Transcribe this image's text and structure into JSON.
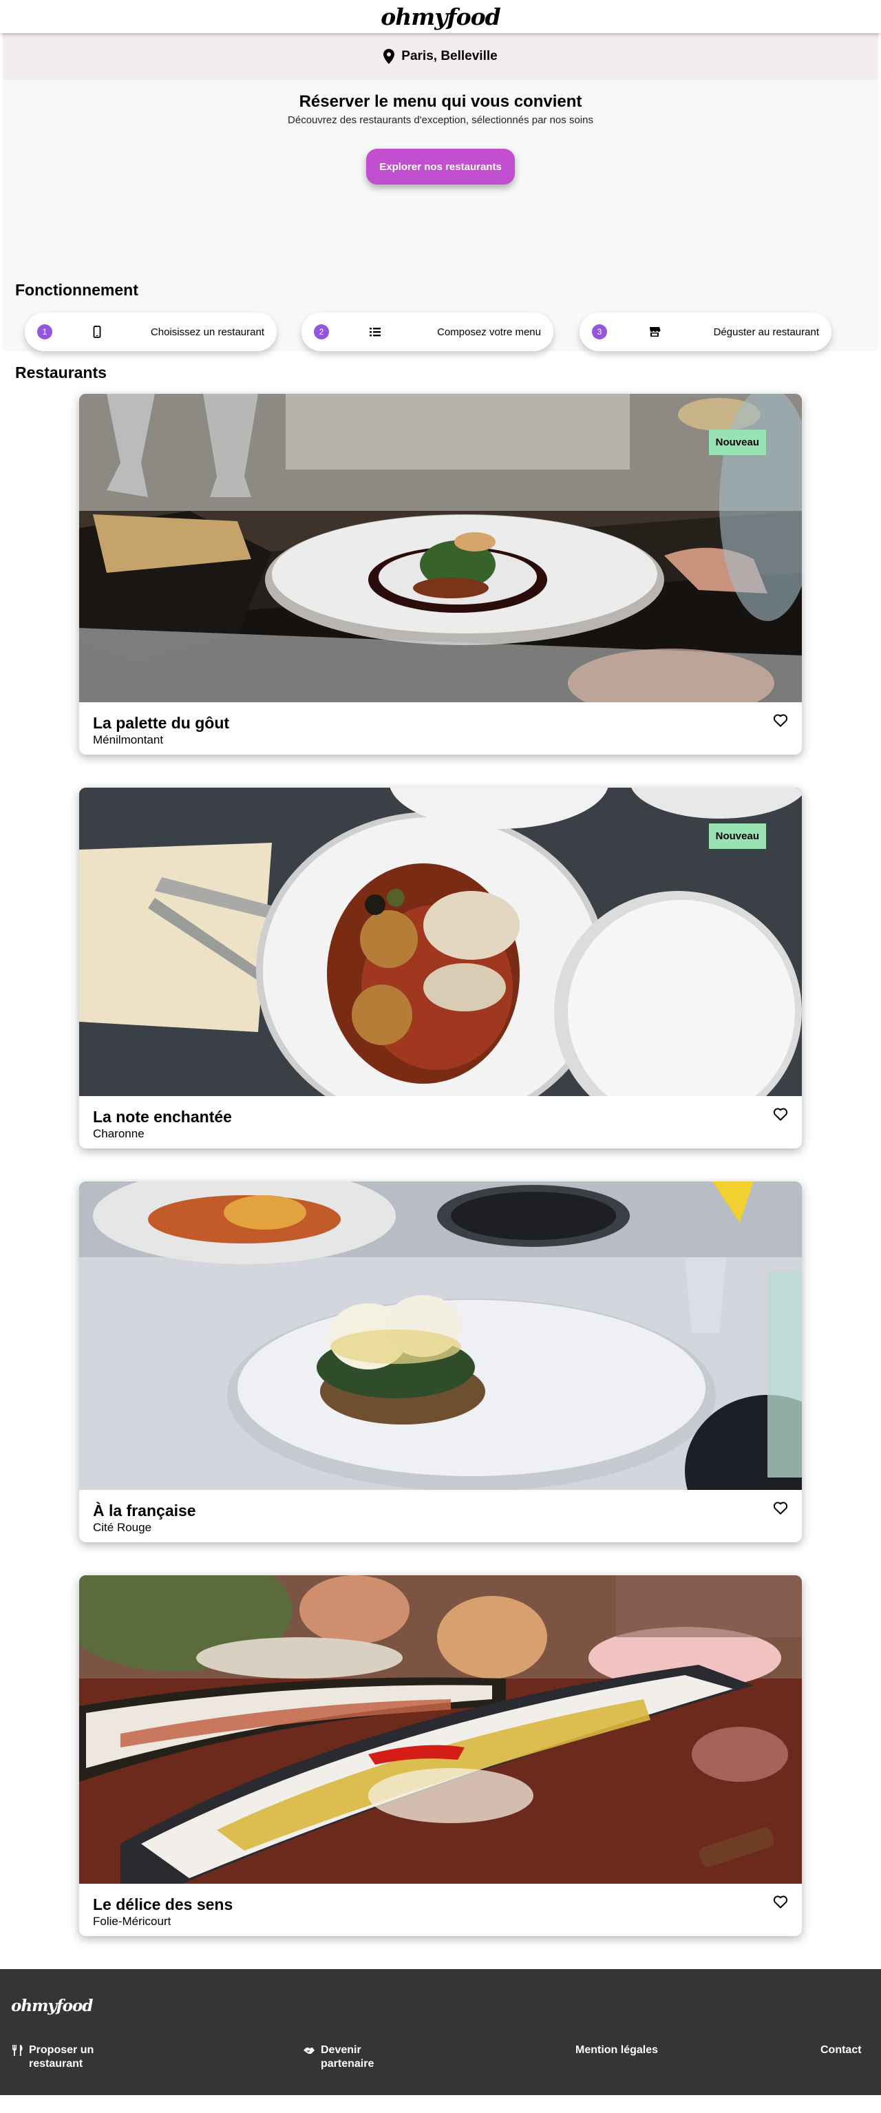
{
  "header": {
    "logo": "ohmyfood"
  },
  "location": {
    "icon": "map-pin-icon",
    "label": "Paris, Belleville"
  },
  "hero": {
    "title": "Réserver le menu qui vous convient",
    "subtitle": "Découvrez des restaurants d'exception, sélectionnés par nos soins",
    "cta": "Explorer nos restaurants"
  },
  "how": {
    "title": "Fonctionnement",
    "steps": [
      {
        "num": "1",
        "icon": "mobile-phone-icon",
        "label": "Choisissez un restaurant"
      },
      {
        "num": "2",
        "icon": "list-icon",
        "label": "Composez votre menu"
      },
      {
        "num": "3",
        "icon": "store-icon",
        "label": "Déguster au restaurant"
      }
    ]
  },
  "restaurants": {
    "title": "Restaurants",
    "items": [
      {
        "name": "La palette du gôut",
        "area": "Ménilmontant",
        "badge": "Nouveau"
      },
      {
        "name": "La note enchantée",
        "area": "Charonne",
        "badge": "Nouveau"
      },
      {
        "name": "À la française",
        "area": "Cité Rouge",
        "badge": ""
      },
      {
        "name": "Le délice des sens",
        "area": "Folie-Méricourt",
        "badge": ""
      }
    ]
  },
  "footer": {
    "logo": "ohmyfood",
    "links": [
      {
        "icon": "utensils-icon",
        "label": "Proposer un restaurant"
      },
      {
        "icon": "handshake-icon",
        "label": "Devenir partenaire"
      },
      {
        "label": "Mention légales"
      },
      {
        "label": "Contact"
      }
    ]
  },
  "colors": {
    "accent": "#9356dc",
    "cta": "#c24fcf",
    "badge": "#99e2b4",
    "footer": "#353535"
  }
}
